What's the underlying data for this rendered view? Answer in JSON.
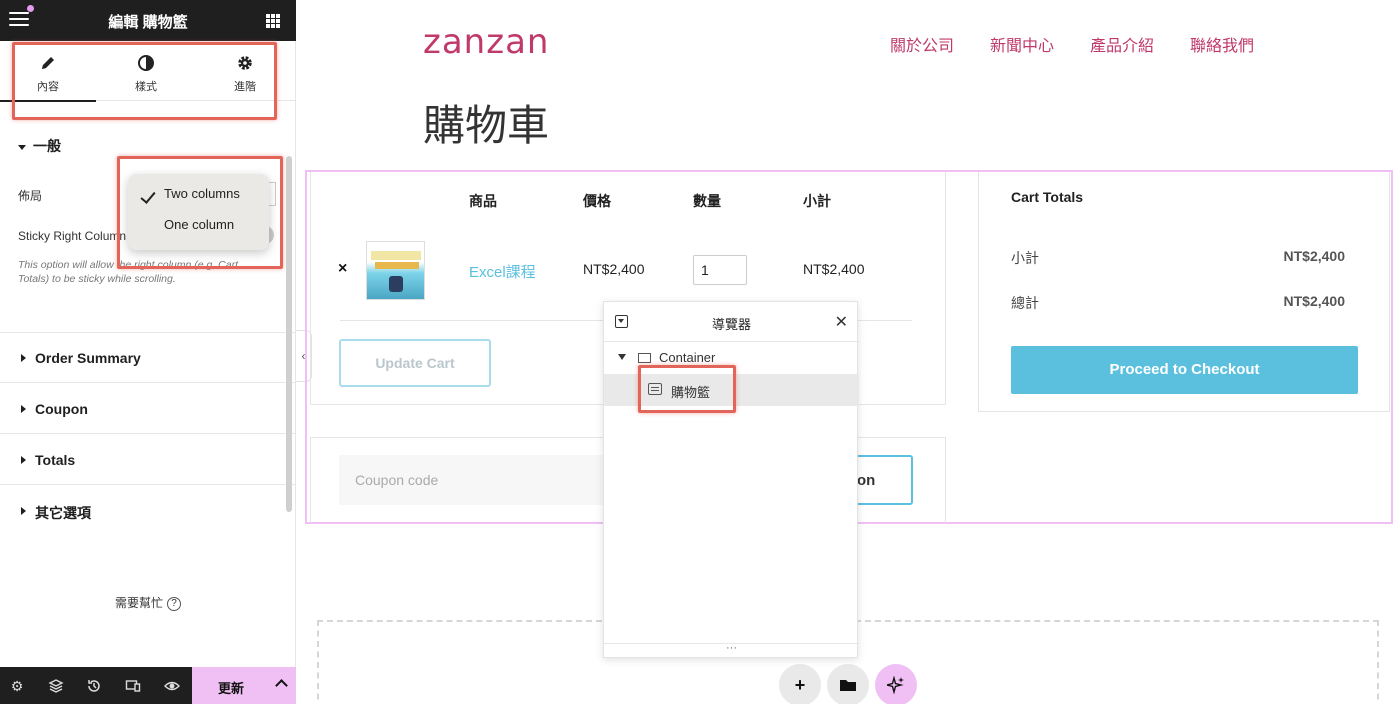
{
  "editor": {
    "title": "編輯 購物籃",
    "tabs": [
      {
        "label": "內容",
        "icon": "pencil-icon"
      },
      {
        "label": "樣式",
        "icon": "half-circle-icon"
      },
      {
        "label": "進階",
        "icon": "gear-icon"
      }
    ],
    "section_general": "一般",
    "layout_label": "佈局",
    "layout_options": [
      "Two columns",
      "One column"
    ],
    "layout_selected": "Two columns",
    "sticky_label": "Sticky Right Column",
    "sticky_hint": "This option will allow the right column (e.g, Cart Totals) to be sticky while scrolling.",
    "sections": [
      "Order Summary",
      "Coupon",
      "Totals",
      "其它選項"
    ],
    "help": "需要幫忙",
    "update": "更新"
  },
  "site": {
    "logo": "zanzan",
    "nav": [
      "關於公司",
      "新聞中心",
      "產品介紹",
      "聯絡我們"
    ],
    "brand_color": "#c0396b"
  },
  "page": {
    "title": "購物車",
    "columns": [
      "商品",
      "價格",
      "數量",
      "小計"
    ],
    "item": {
      "remove": "×",
      "name": "Excel課程",
      "price": "NT$2,400",
      "quantity": "1",
      "subtotal": "NT$2,400"
    },
    "update_cart": "Update Cart",
    "coupon_placeholder": "Coupon code",
    "apply_coupon_visible": "on",
    "totals_title": "Cart Totals",
    "subtotal_label": "小計",
    "subtotal_value": "NT$2,400",
    "total_label": "總計",
    "total_value": "NT$2,400",
    "checkout": "Proceed to Checkout",
    "accent_color": "#5bc0de"
  },
  "navigator": {
    "title": "導覽器",
    "container": "Container",
    "widget": "購物籃",
    "footer": "···"
  },
  "canvas_actions": {
    "add": "+",
    "folder": "folder-icon",
    "ai": "sparkle-icon"
  }
}
